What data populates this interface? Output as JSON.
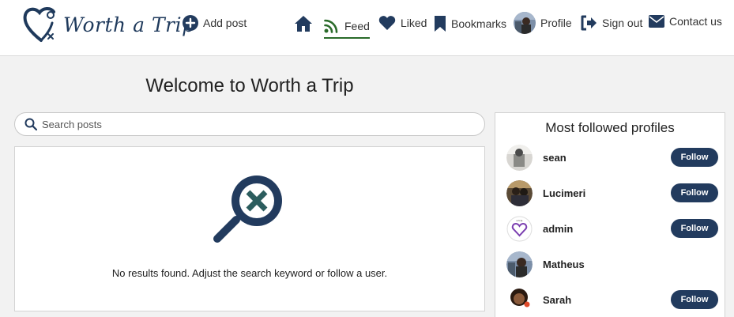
{
  "brand": {
    "name": "Worth a Trip",
    "color": "#1f3a5c"
  },
  "nav": {
    "add_post": "Add post",
    "home_icon": "home-icon",
    "feed": "Feed",
    "liked": "Liked",
    "bookmarks": "Bookmarks",
    "profile": "Profile",
    "sign_out": "Sign out",
    "contact": "Contact us",
    "active_tab": "Feed",
    "active_color": "#2a6b2a"
  },
  "main": {
    "title": "Welcome to Worth a Trip",
    "search": {
      "placeholder": "Search posts",
      "value": ""
    },
    "empty_state": {
      "icon": "magnifier-x-icon",
      "message": "No results found. Adjust the search keyword or follow a user."
    }
  },
  "sidebar": {
    "title": "Most followed profiles",
    "profiles": [
      {
        "name": "sean",
        "follow_label": "Follow"
      },
      {
        "name": "Lucimeri",
        "follow_label": "Follow"
      },
      {
        "name": "admin",
        "follow_label": "Follow"
      },
      {
        "name": "Matheus",
        "follow_label": ""
      },
      {
        "name": "Sarah",
        "follow_label": "Follow"
      }
    ]
  },
  "colors": {
    "primary": "#223b5e",
    "background": "#f2f2f2"
  }
}
